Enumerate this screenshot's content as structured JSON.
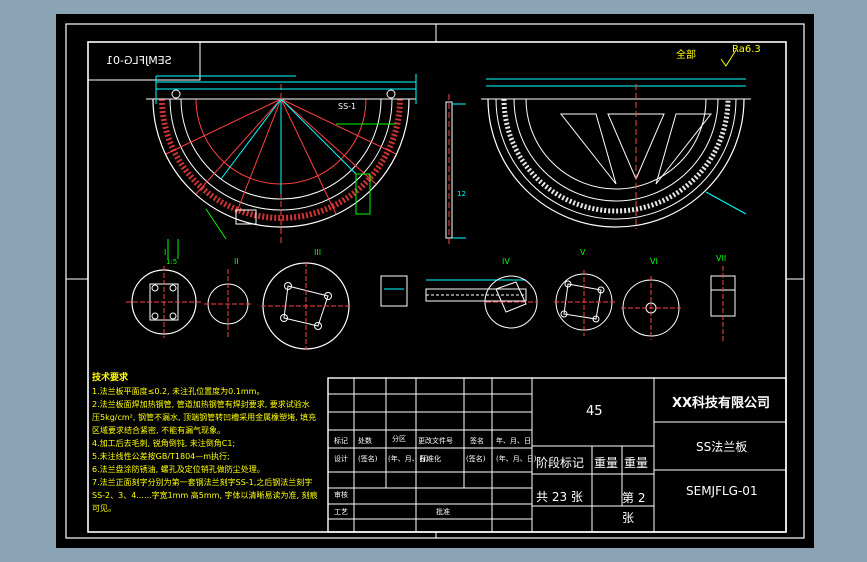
{
  "drawing": {
    "mirrored_code": "SEMJFLG-01",
    "roughness": "全部",
    "roughness_value": "Ra6.3",
    "section_labels": [
      "I",
      "II",
      "III",
      "IV",
      "V",
      "VI",
      "VII"
    ],
    "scale_note": "1:5",
    "technical_requirements": {
      "title": "技术要求",
      "lines": [
        "1.法兰板平面度≤0.2, 未注孔位置度为0.1mm。",
        "2.法兰板面焊加热钢管, 管道加热钢管有焊封要求, 要求试验水",
        "压5kg/cm², 钢管不漏水, 顶端钢管转凹槽采用金属橡塑堵, 填充",
        "区域要求结合紧密, 不能有漏气现象。",
        "4.加工后去毛刺, 锐角倒钝, 未注倒角C1;",
        "5.未注线性公差按GB/T1804—m执行;",
        "6.法兰盘涂防锈油, 螺孔及定位销孔做防尘处理。",
        "7.法兰正面刻字分别为第一套钢法兰刻字SS-1,之后钢法兰刻字",
        "SS-2、3、4......字宽1mm 高5mm, 字体以清晰易读为准, 刻痕",
        "可见。"
      ]
    }
  },
  "title_block": {
    "quantity": "45",
    "company": "XX科技有限公司",
    "part_name": "SS法兰板",
    "drawing_number": "SEMJFLG-01",
    "stage_mark_label": "阶段标记",
    "weight_label": "重量",
    "scale_label": "重量",
    "sheets_total": "共 23 张",
    "sheet_no": "第 2 张",
    "headers": {
      "mark": "标记",
      "count": "处数",
      "zone": "分区",
      "change_doc": "更改文件号",
      "signature": "签名",
      "date": "年、月、日",
      "design": "设计",
      "sign1": "(签名)",
      "date1": "(年、月、日)",
      "standardize": "标准化",
      "sign2": "(签名)",
      "date2": "(年、月、日)",
      "review": "审核",
      "process": "工艺",
      "approve": "批准"
    }
  }
}
